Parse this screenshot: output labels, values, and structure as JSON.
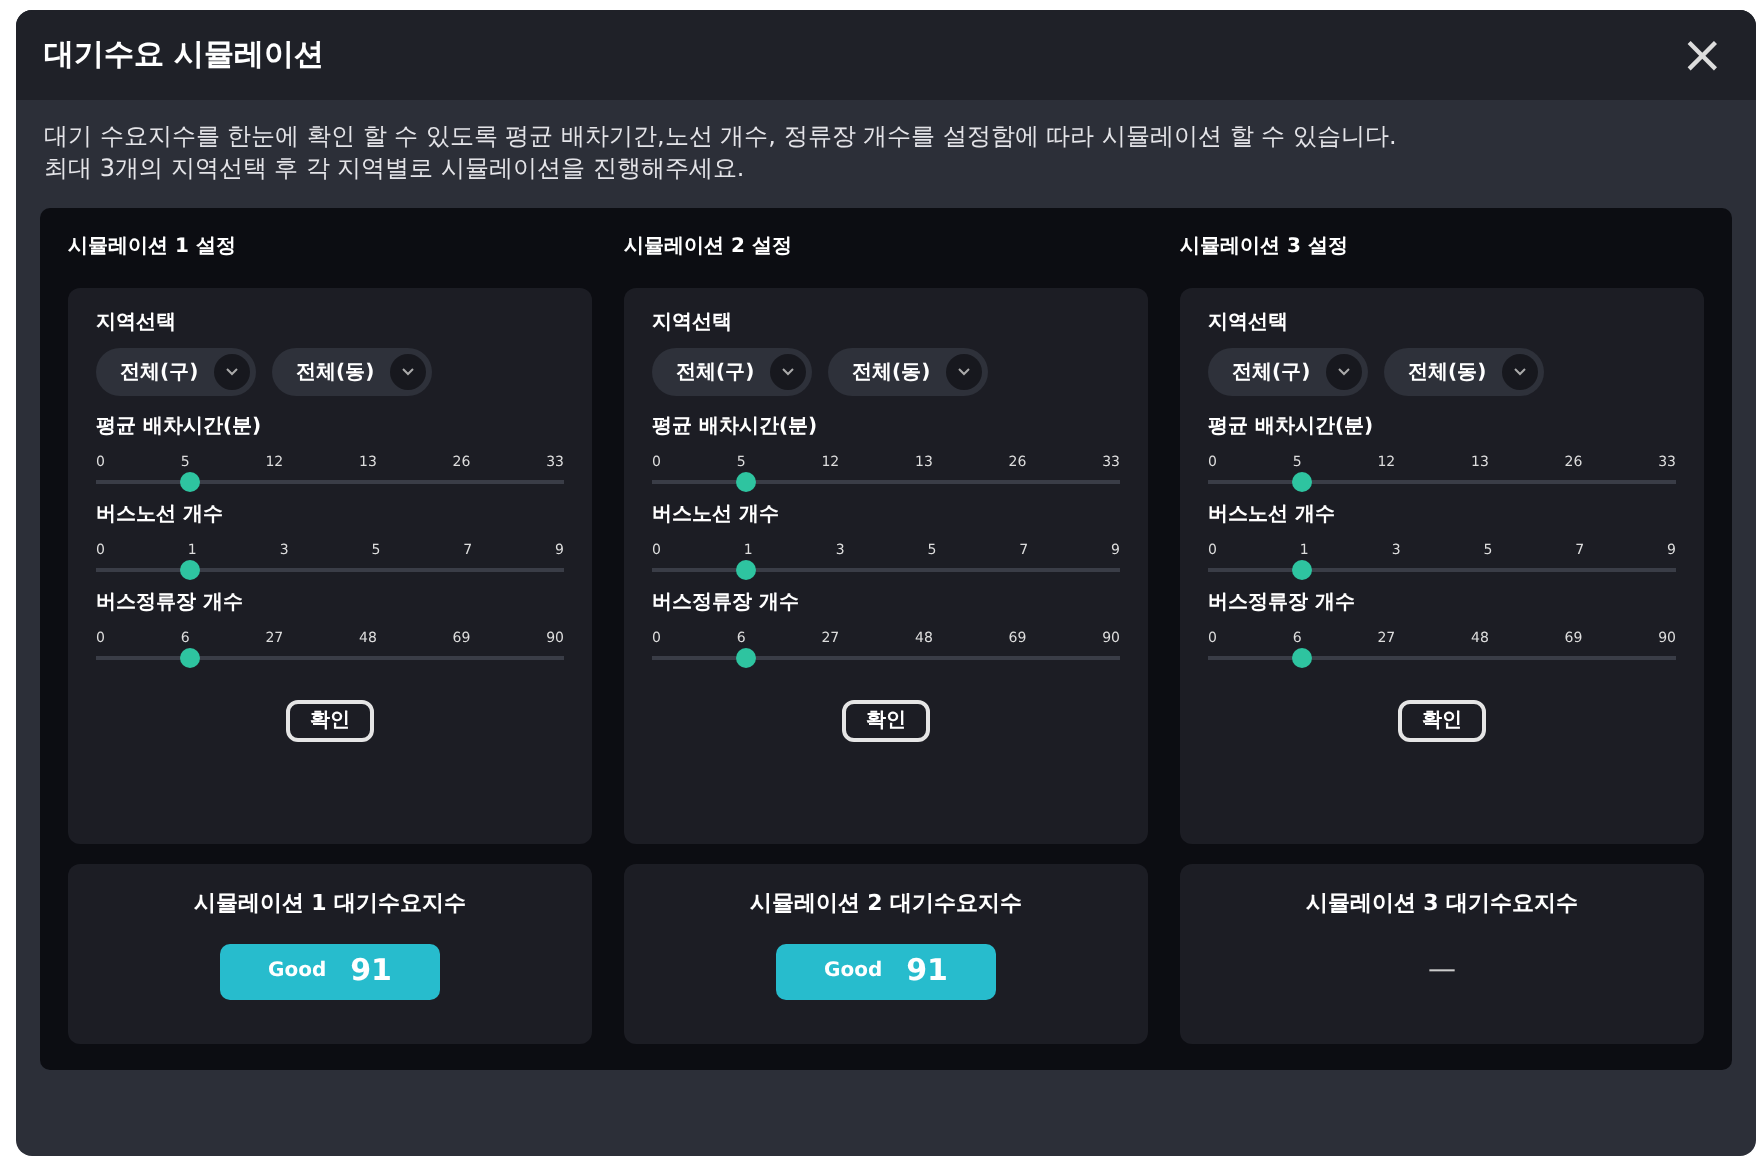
{
  "dialog": {
    "title": "대기수요 시뮬레이션",
    "close": "×"
  },
  "description": [
    "대기 수요지수를 한눈에 확인 할 수 있도록 평균 배차기간,노선 개수, 정류장 개수를 설정함에 따라 시뮬레이션 할 수 있습니다.",
    "최대 3개의 지역선택 후 각 지역별로 시뮬레이션을 진행해주세요."
  ],
  "simulations": [
    {
      "title": "시뮬레이션 1 설정",
      "region_label": "지역선택",
      "selects": [
        "전체(구)",
        "전체(동)"
      ],
      "sliders": [
        {
          "label": "평균 배차시간(분)",
          "ticks": [
            "0",
            "5",
            "12",
            "13",
            "26",
            "33"
          ],
          "level": 0.2
        },
        {
          "label": "버스노선 개수",
          "ticks": [
            "0",
            "1",
            "3",
            "5",
            "7",
            "9"
          ],
          "level": 0.2
        },
        {
          "label": "버스정류장 개수",
          "ticks": [
            "0",
            "6",
            "27",
            "48",
            "69",
            "90"
          ],
          "level": 0.2
        }
      ],
      "confirm": "확인",
      "result_title": "시뮬레이션 1 대기수요지수",
      "result": {
        "kind": "score",
        "grade": "Good",
        "score": "91"
      }
    },
    {
      "title": "시뮬레이션 2 설정",
      "region_label": "지역선택",
      "selects": [
        "전체(구)",
        "전체(동)"
      ],
      "sliders": [
        {
          "label": "평균 배차시간(분)",
          "ticks": [
            "0",
            "5",
            "12",
            "13",
            "26",
            "33"
          ],
          "level": 0.2
        },
        {
          "label": "버스노선 개수",
          "ticks": [
            "0",
            "1",
            "3",
            "5",
            "7",
            "9"
          ],
          "level": 0.2
        },
        {
          "label": "버스정류장 개수",
          "ticks": [
            "0",
            "6",
            "27",
            "48",
            "69",
            "90"
          ],
          "level": 0.2
        }
      ],
      "confirm": "확인",
      "result_title": "시뮬레이션 2 대기수요지수",
      "result": {
        "kind": "score",
        "grade": "Good",
        "score": "91"
      }
    },
    {
      "title": "시뮬레이션 3 설정",
      "region_label": "지역선택",
      "selects": [
        "전체(구)",
        "전체(동)"
      ],
      "sliders": [
        {
          "label": "평균 배차시간(분)",
          "ticks": [
            "0",
            "5",
            "12",
            "13",
            "26",
            "33"
          ],
          "level": 0.2
        },
        {
          "label": "버스노선 개수",
          "ticks": [
            "0",
            "1",
            "3",
            "5",
            "7",
            "9"
          ],
          "level": 0.2
        },
        {
          "label": "버스정류장 개수",
          "ticks": [
            "0",
            "6",
            "27",
            "48",
            "69",
            "90"
          ],
          "level": 0.2
        }
      ],
      "confirm": "확인",
      "result_title": "시뮬레이션 3 대기수요지수",
      "result": {
        "kind": "empty",
        "text": "—"
      }
    }
  ]
}
